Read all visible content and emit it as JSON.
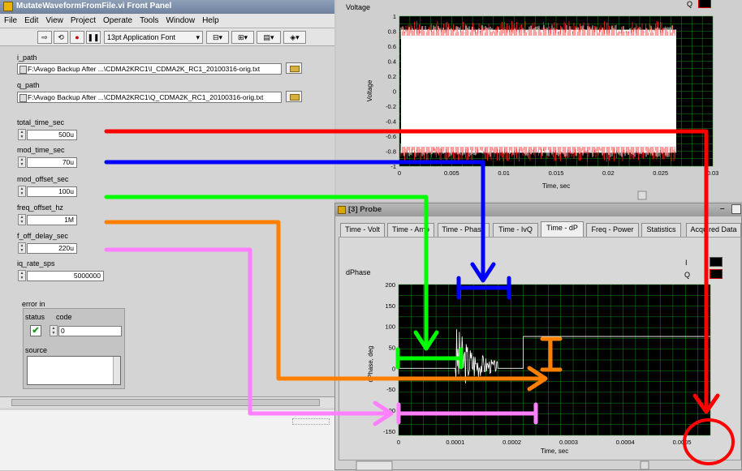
{
  "front_panel": {
    "title": "MutateWaveformFromFile.vi Front Panel",
    "menu": [
      "File",
      "Edit",
      "View",
      "Project",
      "Operate",
      "Tools",
      "Window",
      "Help"
    ],
    "font_selector": "13pt Application Font",
    "i_path": {
      "label": "i_path",
      "value": "F:\\Avago Backup After ...\\CDMA2KRC1\\I_CDMA2K_RC1_20100316-orig.txt"
    },
    "q_path": {
      "label": "q_path",
      "value": "F:\\Avago Backup After ...\\CDMA2KRC1\\Q_CDMA2K_RC1_20100316-orig.txt"
    },
    "controls": [
      {
        "label": "total_time_sec",
        "value": "500u"
      },
      {
        "label": "mod_time_sec",
        "value": "70u"
      },
      {
        "label": "mod_offset_sec",
        "value": "100u"
      },
      {
        "label": "freq_offset_hz",
        "value": "1M"
      },
      {
        "label": "f_off_delay_sec",
        "value": "220u"
      },
      {
        "label": "iq_rate_sps",
        "value": "5000000"
      }
    ],
    "error_in": {
      "label": "error in",
      "status_label": "status",
      "code_label": "code",
      "code_value": "0",
      "source_label": "source",
      "status_mark": "✔"
    }
  },
  "voltage_window": {
    "graph_label": "Voltage",
    "legend_q": "Q",
    "ylabel": "Voltage",
    "xlabel": "Time, sec",
    "yticks": [
      "1",
      "0.8",
      "0.6",
      "0.4",
      "0.2",
      "0",
      "-0.2",
      "-0.4",
      "-0.6",
      "-0.8",
      "-1"
    ],
    "xticks": [
      "0",
      "0.005",
      "0.01",
      "0.015",
      "0.02",
      "0.025",
      "0.03"
    ]
  },
  "probe_window": {
    "title": "[3] Probe",
    "tabs": [
      "Time - Volt",
      "Time - Amp",
      "Time - Phase",
      "Time - IvQ",
      "Time - dP",
      "Freq - Power",
      "Statistics",
      "Acquired Data"
    ],
    "active_tab": "Time - dP",
    "graph_label": "dPhase",
    "legend": [
      "I",
      "Q"
    ],
    "ylabel": "dPhase, deg",
    "xlabel": "Time, sec",
    "yticks": [
      "200",
      "150",
      "100",
      "50",
      "0",
      "-50",
      "-100",
      "-150"
    ],
    "xticks": [
      "0",
      "0.0001",
      "0.0002",
      "0.0003",
      "0.0004",
      "0.0005"
    ]
  },
  "colors": {
    "total_time": "#ff0000",
    "mod_time": "#0000ff",
    "mod_offset": "#00ff00",
    "freq_offset": "#ff8000",
    "f_off_delay": "#ff80ff",
    "grid": "#1f8a1f",
    "plot_bg": "#000000"
  }
}
